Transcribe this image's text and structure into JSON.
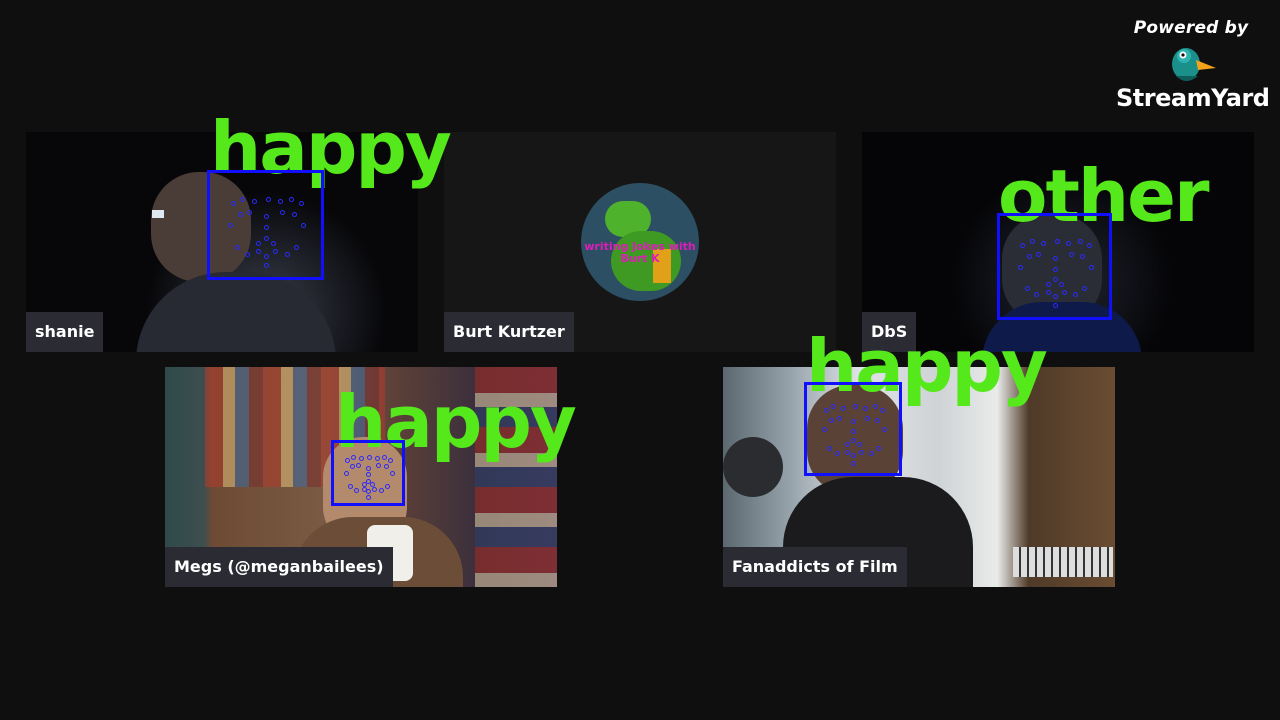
{
  "branding": {
    "powered_by": "Powered by",
    "name": "StreamYard",
    "logo_icon": "duck-logo-icon"
  },
  "participants": [
    {
      "name": "shanie",
      "emotion": "happy",
      "video": "camera-feed"
    },
    {
      "name": "Burt Kurtzer",
      "video": "avatar",
      "avatar_text": "writing Jokes with Burt K"
    },
    {
      "name": "DbS",
      "emotion": "other",
      "video": "camera-feed"
    },
    {
      "name": "Megs (@meganbailees)",
      "emotion": "happy",
      "video": "camera-feed"
    },
    {
      "name": "Fanaddicts of Film",
      "emotion": "happy",
      "video": "camera-feed"
    }
  ],
  "colors": {
    "background": "#0f0f0f",
    "name_tag_bg": "#2a2b33",
    "emotion_label": "#55e81b",
    "face_box": "#1010ff",
    "avatar_text": "#e01cb8"
  }
}
